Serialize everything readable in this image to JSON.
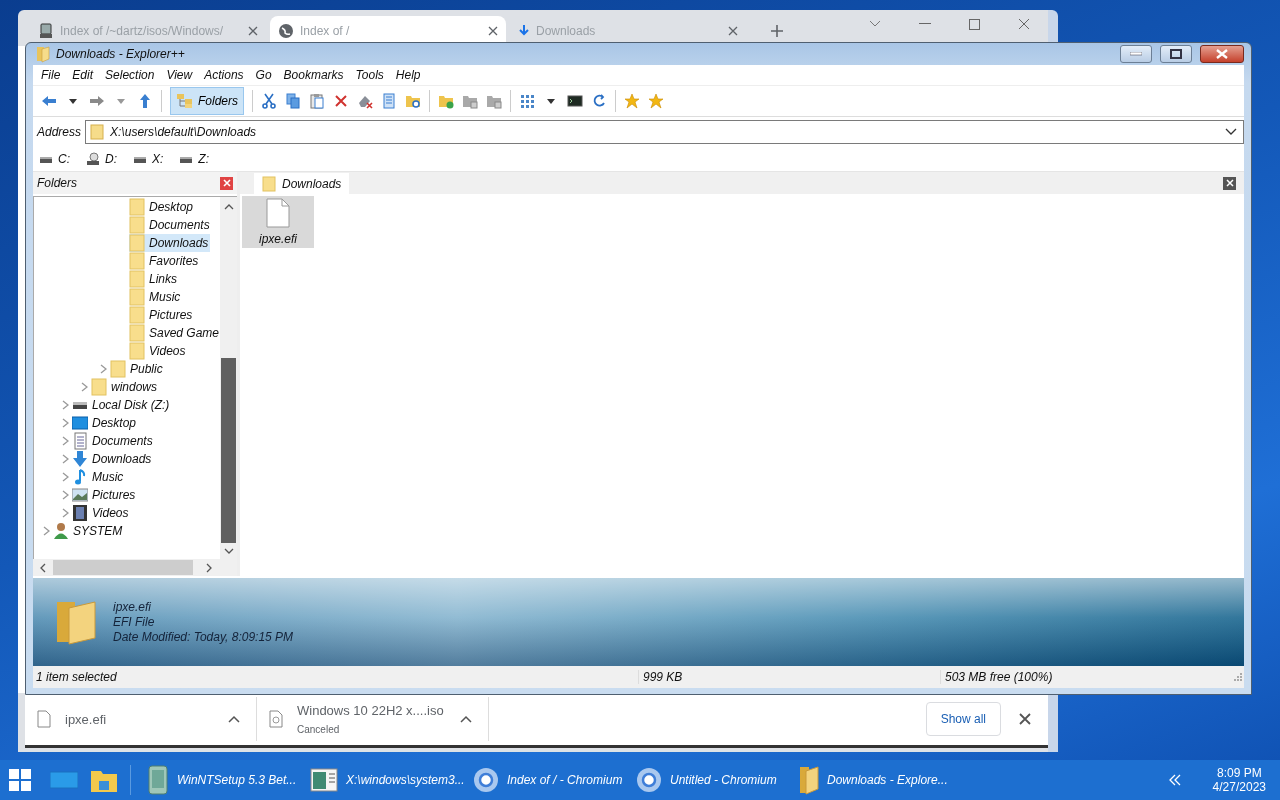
{
  "browser": {
    "tabs": [
      {
        "title": "Index of /~dartz/isos/Windows/",
        "kind": "server",
        "selected": false
      },
      {
        "title": "Index of /",
        "kind": "globe",
        "selected": true
      },
      {
        "title": "Downloads",
        "kind": "download",
        "selected": false
      }
    ],
    "downloads": [
      {
        "name": "ipxe.efi",
        "kind": "file"
      },
      {
        "name": "Windows 10 22H2 x....iso",
        "status": "Canceled",
        "kind": "disc"
      }
    ],
    "show_all": "Show all"
  },
  "explorer": {
    "title": "Downloads - Explorer++",
    "menu": [
      "File",
      "Edit",
      "Selection",
      "View",
      "Actions",
      "Go",
      "Bookmarks",
      "Tools",
      "Help"
    ],
    "folders_button": {
      "label": "Folders",
      "selected": true
    },
    "address": {
      "label": "Address",
      "value": "X:\\users\\default\\Downloads"
    },
    "drives": [
      {
        "label": "C:",
        "kind": "disk"
      },
      {
        "label": "D:",
        "kind": "cd"
      },
      {
        "label": "X:",
        "kind": "disk"
      },
      {
        "label": "Z:",
        "kind": "disk"
      }
    ],
    "folders_pane": {
      "title": "Folders"
    },
    "tree": [
      {
        "children": [
          {
            "children": [
              {
                "children": [
                  {
                    "children": [
                      {
                        "label": "Desktop",
                        "kind": "folder",
                        "selected": false
                      },
                      {
                        "label": "Documents",
                        "kind": "folder",
                        "selected": false
                      },
                      {
                        "label": "Downloads",
                        "kind": "folder",
                        "selected": true
                      },
                      {
                        "label": "Favorites",
                        "kind": "folder",
                        "selected": false
                      },
                      {
                        "label": "Links",
                        "kind": "folder",
                        "selected": false
                      },
                      {
                        "label": "Music",
                        "kind": "folder",
                        "selected": false
                      },
                      {
                        "label": "Pictures",
                        "kind": "folder",
                        "selected": false
                      },
                      {
                        "label": "Saved Game",
                        "kind": "folder",
                        "selected": false
                      },
                      {
                        "label": "Videos",
                        "kind": "folder",
                        "selected": false
                      }
                    ]
                  },
                  {
                    "label": "Public",
                    "kind": "folder",
                    "expanded": false,
                    "selected": false
                  }
                ]
              },
              {
                "label": "windows",
                "kind": "folder",
                "expanded": false,
                "selected": false
              }
            ]
          },
          {
            "label": "Local Disk (Z:)",
            "kind": "drive",
            "expanded": false,
            "selected": false
          },
          {
            "label": "Desktop",
            "kind": "desktop",
            "expanded": false,
            "selected": false
          },
          {
            "label": "Documents",
            "kind": "documents",
            "expanded": false,
            "selected": false
          },
          {
            "label": "Downloads",
            "kind": "downloads",
            "expanded": false,
            "selected": false
          },
          {
            "label": "Music",
            "kind": "music",
            "expanded": false,
            "selected": false
          },
          {
            "label": "Pictures",
            "kind": "pictures",
            "expanded": false,
            "selected": false
          },
          {
            "label": "Videos",
            "kind": "videos",
            "expanded": false,
            "selected": false
          }
        ]
      },
      {
        "label": "SYSTEM",
        "kind": "user",
        "expanded": false,
        "selected": false
      }
    ],
    "tab": {
      "label": "Downloads"
    },
    "files": [
      {
        "name": "ipxe.efi",
        "selected": true
      }
    ],
    "info": {
      "name": "ipxe.efi",
      "type": "EFI File",
      "modified": "Date Modified: Today, 8:09:15 PM"
    },
    "status_bar": [
      "1 item selected",
      "999 KB",
      "503 MB free (100%)"
    ]
  },
  "taskbar": {
    "items": [
      {
        "label": "WinNTSetup 5.3 Bet...",
        "kind": "setup"
      },
      {
        "label": "X:\\windows\\system3...",
        "kind": "console"
      },
      {
        "label": "Index of / - Chromium",
        "kind": "chromium"
      },
      {
        "label": "Untitled - Chromium",
        "kind": "chromium"
      },
      {
        "label": "Downloads - Explore...",
        "kind": "explorer"
      }
    ],
    "time": "8:09 PM",
    "date": "4/27/2023"
  }
}
